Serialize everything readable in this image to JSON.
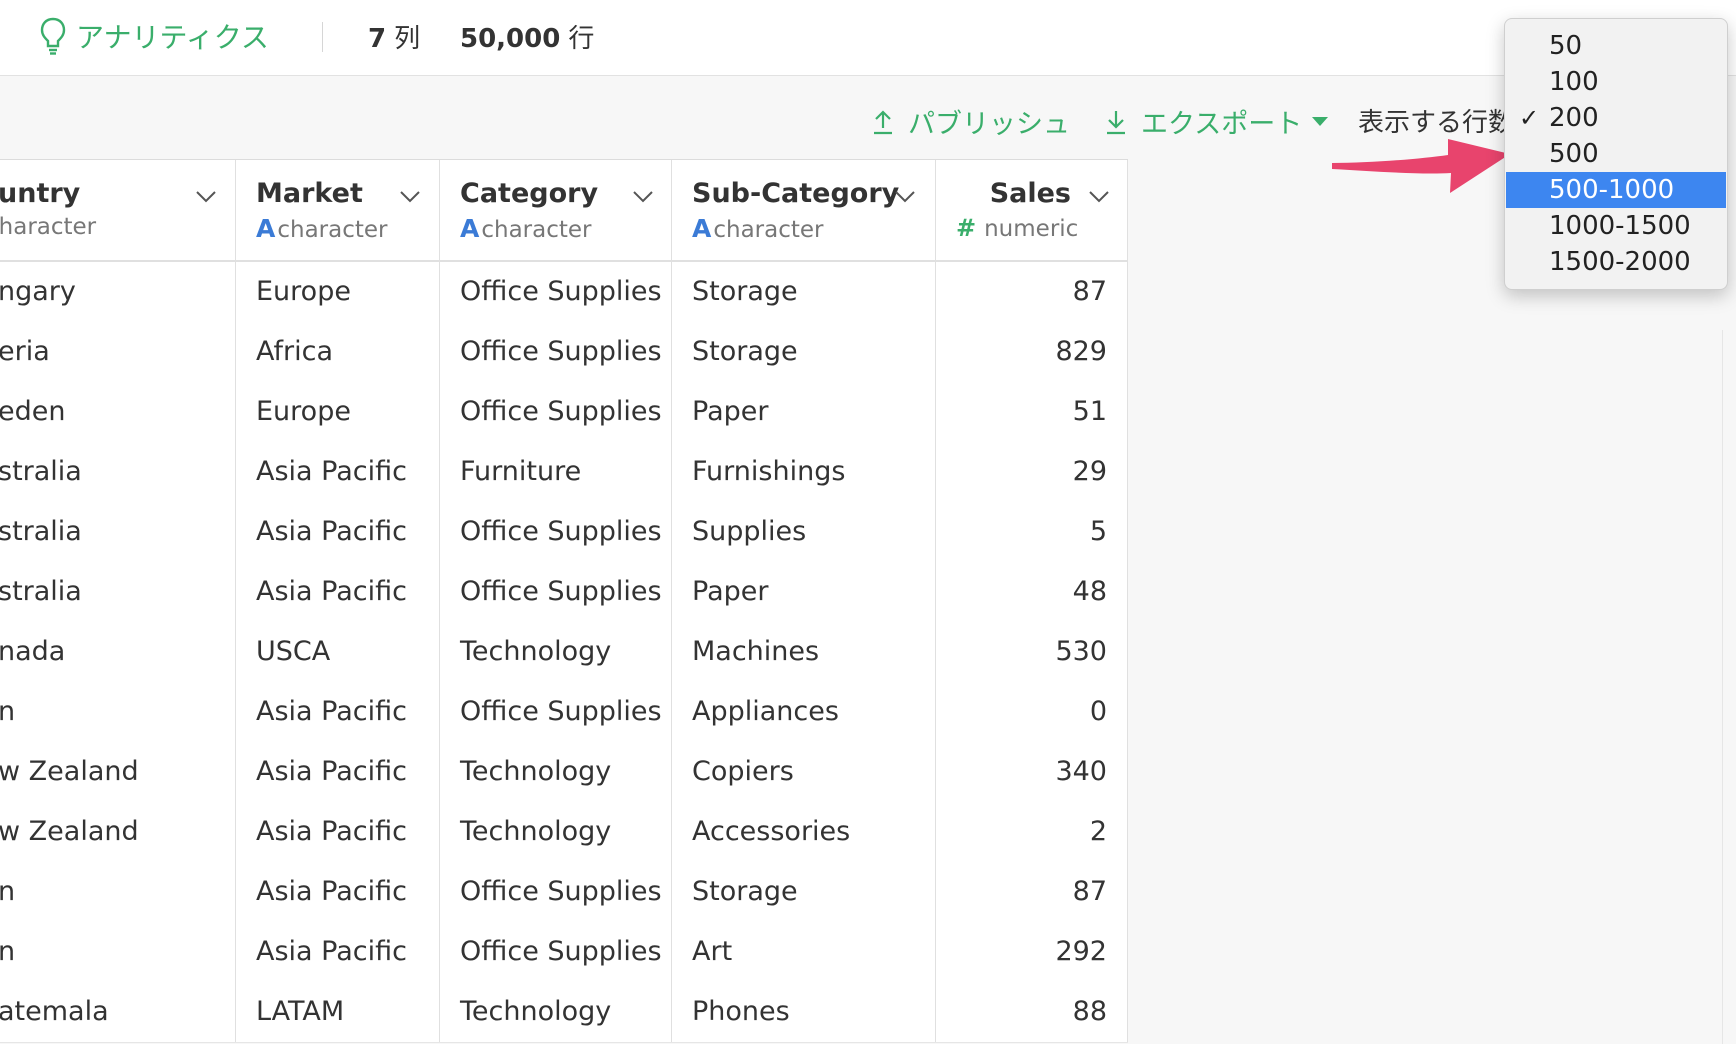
{
  "header": {
    "app_label": "アナリティクス",
    "columns_count": "7",
    "columns_unit": "列",
    "rows_count": "50,000",
    "rows_unit": "行"
  },
  "toolbar": {
    "publish_label": "パブリッシュ",
    "export_label": "エクスポート",
    "rows_label": "表示する行数"
  },
  "columns": [
    {
      "name": "untry",
      "type": "character"
    },
    {
      "name": "Market",
      "type": "character",
      "type_icon": "A"
    },
    {
      "name": "Category",
      "type": "character",
      "type_icon": "A"
    },
    {
      "name": "Sub-Category",
      "type": "character",
      "type_icon": "A"
    },
    {
      "name": "Sales",
      "type": "numeric",
      "type_icon": "#"
    }
  ],
  "rows": [
    [
      "ngary",
      "Europe",
      "Office Supplies",
      "Storage",
      "87"
    ],
    [
      "eria",
      "Africa",
      "Office Supplies",
      "Storage",
      "829"
    ],
    [
      "eden",
      "Europe",
      "Office Supplies",
      "Paper",
      "51"
    ],
    [
      "stralia",
      "Asia Pacific",
      "Furniture",
      "Furnishings",
      "29"
    ],
    [
      "stralia",
      "Asia Pacific",
      "Office Supplies",
      "Supplies",
      "5"
    ],
    [
      "stralia",
      "Asia Pacific",
      "Office Supplies",
      "Paper",
      "48"
    ],
    [
      "nada",
      "USCA",
      "Technology",
      "Machines",
      "530"
    ],
    [
      "n",
      "Asia Pacific",
      "Office Supplies",
      "Appliances",
      "0"
    ],
    [
      "w Zealand",
      "Asia Pacific",
      "Technology",
      "Copiers",
      "340"
    ],
    [
      "w Zealand",
      "Asia Pacific",
      "Technology",
      "Accessories",
      "2"
    ],
    [
      "n",
      "Asia Pacific",
      "Office Supplies",
      "Storage",
      "87"
    ],
    [
      "n",
      "Asia Pacific",
      "Office Supplies",
      "Art",
      "292"
    ],
    [
      "atemala",
      "LATAM",
      "Technology",
      "Phones",
      "88"
    ]
  ],
  "rows_dropdown": {
    "options": [
      "50",
      "100",
      "200",
      "500",
      "500-1000",
      "1000-1500",
      "1500-2000"
    ],
    "checked": "200",
    "highlighted": "500-1000",
    "check_mark": "✓"
  },
  "colors": {
    "accent_green": "#3aae6b",
    "type_blue": "#3b7bd6",
    "highlight_blue": "#3d86f0",
    "arrow_pink": "#e8446d"
  },
  "icons": [
    "lightbulb-icon",
    "upload-icon",
    "download-icon",
    "caret-down-icon",
    "chevron-down-icon",
    "check-icon",
    "annotation-arrow-icon"
  ]
}
